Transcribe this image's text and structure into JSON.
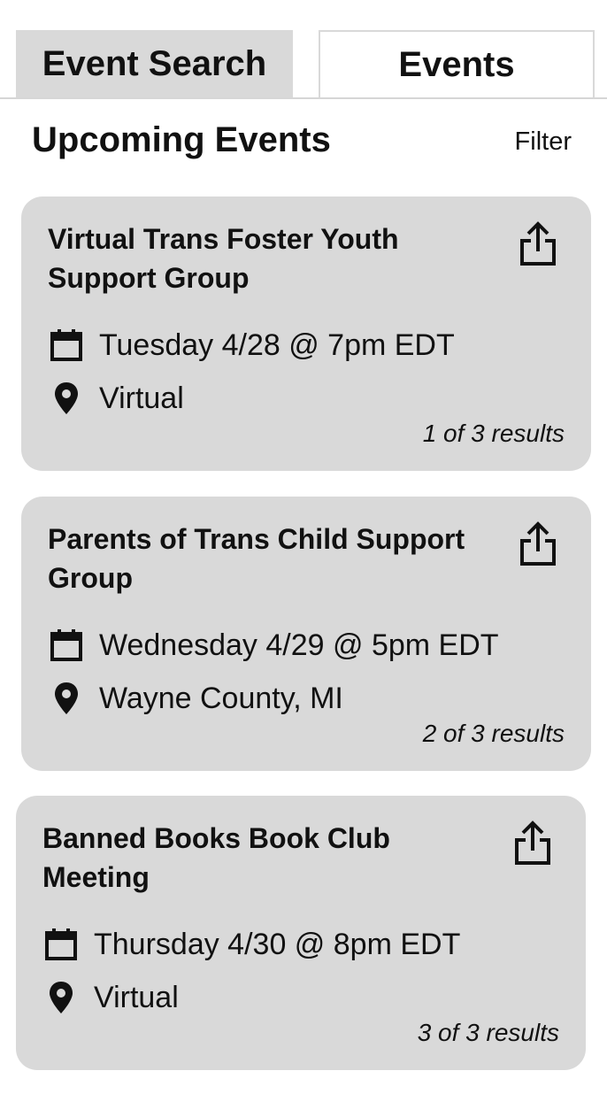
{
  "tabs": [
    {
      "label": "Event Search",
      "active": true
    },
    {
      "label": "Events",
      "active": false
    }
  ],
  "header": {
    "title": "Upcoming Events",
    "filter_label": "Filter"
  },
  "events": [
    {
      "title": "Virtual Trans Foster Youth Support Group",
      "datetime": "Tuesday 4/28 @ 7pm EDT",
      "location": "Virtual",
      "results": "1 of 3 results"
    },
    {
      "title": "Parents of Trans Child Support Group",
      "datetime": "Wednesday 4/29 @ 5pm EDT",
      "location": "Wayne County, MI",
      "results": "2 of 3 results"
    },
    {
      "title": "Banned Books Book Club Meeting",
      "datetime": "Thursday 4/30 @ 8pm EDT",
      "location": "Virtual",
      "results": "3 of 3 results"
    }
  ],
  "icons": {
    "share": "share-icon",
    "calendar": "calendar-icon",
    "location": "location-pin-icon"
  },
  "colors": {
    "card_background": "#d9d9d9",
    "active_tab": "#d9d9d9",
    "text": "#111111"
  }
}
